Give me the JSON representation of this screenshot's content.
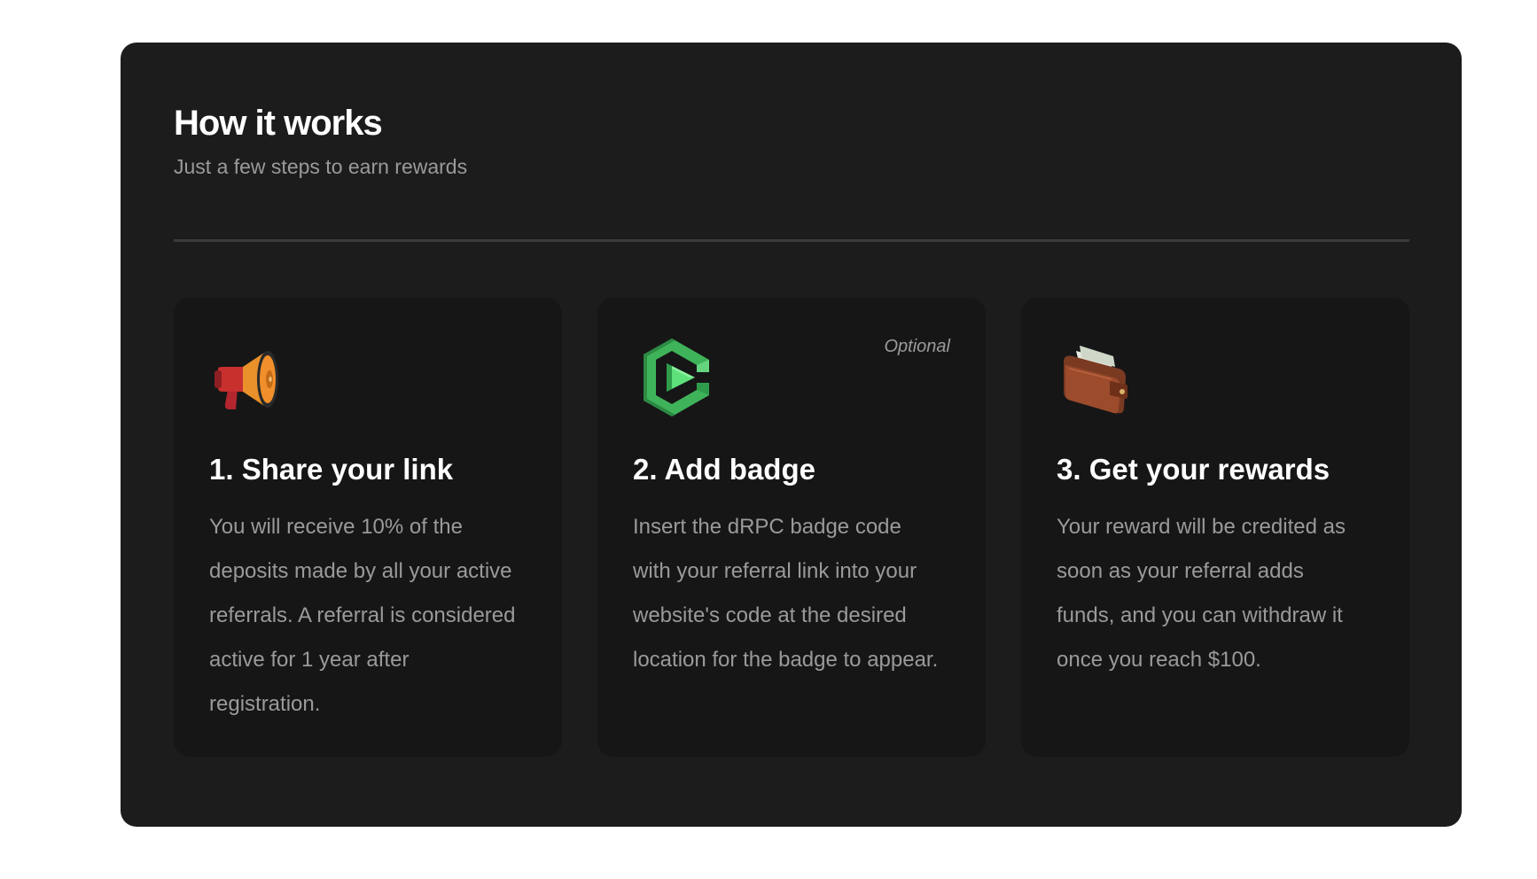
{
  "section": {
    "title": "How it works",
    "subtitle": "Just a few steps to earn rewards"
  },
  "steps": [
    {
      "icon": "megaphone-icon",
      "title": "1. Share your link",
      "body": "You will receive 10% of the deposits made by all your active referrals. A referral is considered active for 1 year after registration.",
      "tag": ""
    },
    {
      "icon": "drpc-badge-icon",
      "title": "2. Add badge",
      "body": "Insert the dRPC badge code with your referral link into your website's code at the desired location for the badge to appear.",
      "tag": "Optional"
    },
    {
      "icon": "wallet-icon",
      "title": "3. Get your rewards",
      "body": "Your reward will be credited as soon as your referral adds funds, and you can withdraw it once you reach $100.",
      "tag": ""
    }
  ],
  "colors": {
    "panel_background": "#1c1c1d",
    "card_background": "#161617",
    "title_text": "#ffffff",
    "secondary_text": "#9a9a9a",
    "badge_green": "#4fd36a"
  }
}
